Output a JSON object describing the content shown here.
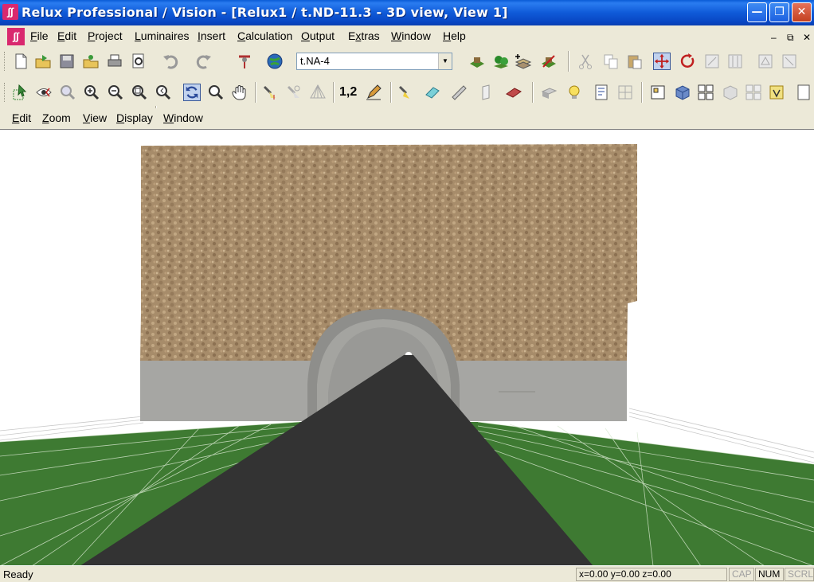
{
  "window": {
    "title": "Relux Professional / Vision - [Relux1 /  t.ND-11.3 - 3D view, View 1]",
    "logo_text": "∫∫",
    "minimize_glyph": "—",
    "maximize_glyph": "❐",
    "close_glyph": "✕"
  },
  "menubar": {
    "items": [
      {
        "label": "File",
        "key": "F"
      },
      {
        "label": "Edit",
        "key": "E"
      },
      {
        "label": "Project",
        "key": "P"
      },
      {
        "label": "Luminaires",
        "key": "L"
      },
      {
        "label": "Insert",
        "key": "I"
      },
      {
        "label": "Calculation",
        "key": "C"
      },
      {
        "label": "Output",
        "key": "O"
      },
      {
        "label": "Extras",
        "key": "x"
      },
      {
        "label": "Window",
        "key": "W"
      },
      {
        "label": "Help",
        "key": "H"
      }
    ],
    "mdi_controls": [
      "‒",
      "⧉",
      "✕"
    ]
  },
  "toolbar1": {
    "project_select": {
      "value": "t.NA-4"
    },
    "icons": [
      "new-file-icon",
      "open-folder-icon",
      "save-icon",
      "open-project-icon",
      "print-icon",
      "print-preview-icon",
      "undo-icon",
      "redo-icon",
      "luminaire-pole-icon",
      "globe-icon",
      "room-green-icon",
      "room-trees-icon",
      "add-layer-icon",
      "delete-room-icon",
      "cut-icon",
      "copy-icon",
      "paste-icon",
      "move-icon",
      "rotate-icon",
      "align-icon",
      "distribute-icon",
      "mirror-icon",
      "scale-icon"
    ]
  },
  "toolbar2": {
    "icons": [
      "select-arrow-icon",
      "eye-icon",
      "zoom-window-icon",
      "zoom-in-icon",
      "zoom-out-icon",
      "zoom-all-icon",
      "zoom-previous-icon",
      "rotate-view-icon",
      "magnifier-icon",
      "pan-hand-icon",
      "spotlight-icon",
      "light-beam-icon",
      "light-cone-icon",
      "numbering-icon",
      "pencil-icon",
      "flashlight-icon",
      "eraser-icon",
      "measure-icon",
      "wall-icon",
      "floor-icon",
      "furniture-icon",
      "light-bulb-icon",
      "report-icon",
      "grid-icon",
      "room-plan-icon",
      "cube-icon",
      "layout-icon",
      "cube-grey-icon",
      "frame-icon",
      "note-icon",
      "page-icon"
    ],
    "numbering_text": "1,2"
  },
  "childmenu": {
    "items": [
      {
        "label": "Edit",
        "key": "E"
      },
      {
        "label": "Zoom",
        "key": "Z"
      },
      {
        "label": "View",
        "key": "V"
      },
      {
        "label": "Display",
        "key": "D"
      },
      {
        "label": "Window",
        "key": "W"
      }
    ]
  },
  "scene": {
    "sky_color": "#ffffff",
    "grass_color": "#3e7a32",
    "road_color": "#333333",
    "wall_color": "#a6a6a3",
    "stone_color": "#a8906e",
    "tunnel_color": "#8e8e8b"
  },
  "statusbar": {
    "text": "Ready",
    "coords": "x=0.00 y=0.00 z=0.00",
    "cap": "CAP",
    "num": "NUM",
    "scrl": "SCRL"
  }
}
